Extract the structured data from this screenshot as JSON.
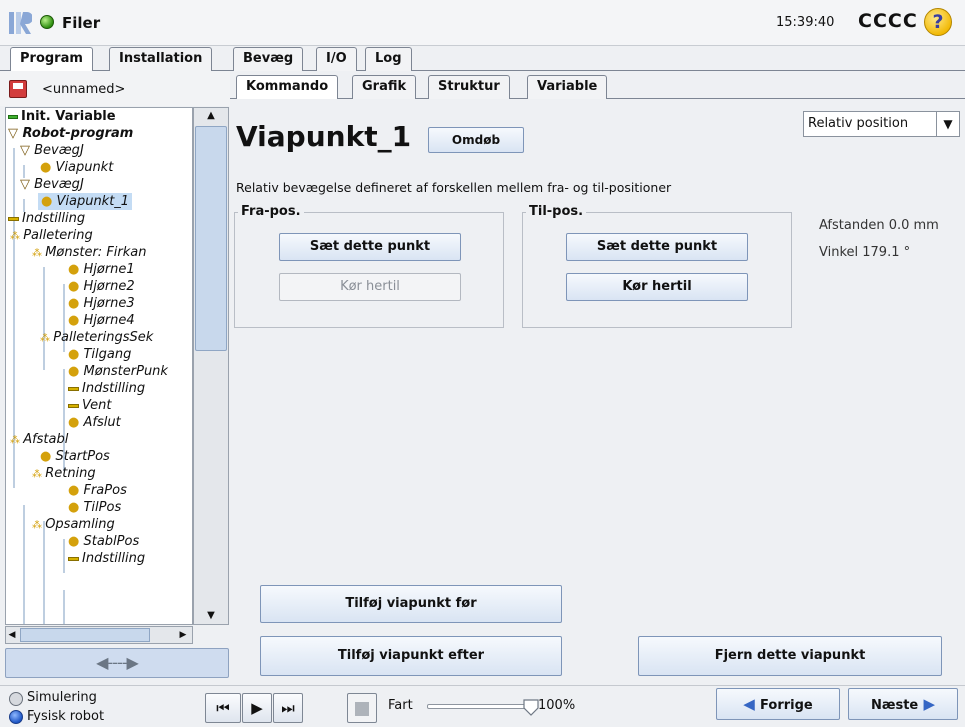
{
  "header": {
    "file_label": "Filer",
    "clock": "15:39:40",
    "robot_name": "CCCC",
    "help": "?"
  },
  "main_tabs": [
    {
      "label": "Program",
      "active": true
    },
    {
      "label": "Installation",
      "active": false
    },
    {
      "label": "Bevæg",
      "active": false
    },
    {
      "label": "I/O",
      "active": false
    },
    {
      "label": "Log",
      "active": false
    }
  ],
  "program": {
    "name": "<unnamed>"
  },
  "tree": [
    {
      "label": "Init. Variable",
      "icon": "green-dash"
    },
    {
      "label": "Robot-program",
      "icon": "triangle"
    },
    {
      "label": "BevægJ",
      "icon": "triangle"
    },
    {
      "label": "Viapunkt",
      "icon": "dot"
    },
    {
      "label": "BevægJ",
      "icon": "triangle"
    },
    {
      "label": "Viapunkt_1",
      "icon": "dot",
      "selected": true
    },
    {
      "label": "Indstilling",
      "icon": "yellow-dash"
    },
    {
      "label": "Palletering",
      "icon": "group"
    },
    {
      "label": "Mønster: Firkan",
      "icon": "group"
    },
    {
      "label": "Hjørne1",
      "icon": "dot"
    },
    {
      "label": "Hjørne2",
      "icon": "dot"
    },
    {
      "label": "Hjørne3",
      "icon": "dot"
    },
    {
      "label": "Hjørne4",
      "icon": "dot"
    },
    {
      "label": "PalleteringsSek",
      "icon": "group"
    },
    {
      "label": "Tilgang",
      "icon": "dot"
    },
    {
      "label": "MønsterPunk",
      "icon": "dot"
    },
    {
      "label": "Indstilling",
      "icon": "yellow-dash"
    },
    {
      "label": "Vent",
      "icon": "yellow-dash"
    },
    {
      "label": "Afslut",
      "icon": "dot"
    },
    {
      "label": "Afstabl",
      "icon": "group"
    },
    {
      "label": "StartPos",
      "icon": "dot"
    },
    {
      "label": "Retning",
      "icon": "group"
    },
    {
      "label": "FraPos",
      "icon": "dot"
    },
    {
      "label": "TilPos",
      "icon": "dot"
    },
    {
      "label": "Opsamling",
      "icon": "group"
    },
    {
      "label": "StablPos",
      "icon": "dot"
    },
    {
      "label": "Indstilling",
      "icon": "yellow-dash"
    }
  ],
  "sub_tabs": [
    {
      "label": "Kommando",
      "active": true
    },
    {
      "label": "Grafik",
      "active": false
    },
    {
      "label": "Struktur",
      "active": false
    },
    {
      "label": "Variable",
      "active": false
    }
  ],
  "command": {
    "title": "Viapunkt_1",
    "rename": "Omdøb",
    "mode": "Relativ position",
    "description": "Relativ bevægelse defineret af forskellen mellem fra- og til-positioner",
    "from_legend": "Fra-pos.",
    "to_legend": "Til-pos.",
    "set_point": "Sæt dette punkt",
    "move_here": "Kør hertil",
    "distance": "Afstanden 0.0 mm",
    "angle": "Vinkel 179.1 °",
    "add_before": "Tilføj viapunkt før",
    "add_after": "Tilføj viapunkt efter",
    "remove": "Fjern dette viapunkt"
  },
  "footer": {
    "simulation": "Simulering",
    "physical": "Fysisk robot",
    "speed_label": "Fart",
    "speed_value": "100%",
    "speed_fraction": 1.0,
    "prev": "Forrige",
    "next": "Næste"
  },
  "colors": {
    "accent": "#3566c4",
    "button_top": "#f6f9fd",
    "button_bottom": "#d9e4f3",
    "selection": "#c4dcf4"
  }
}
